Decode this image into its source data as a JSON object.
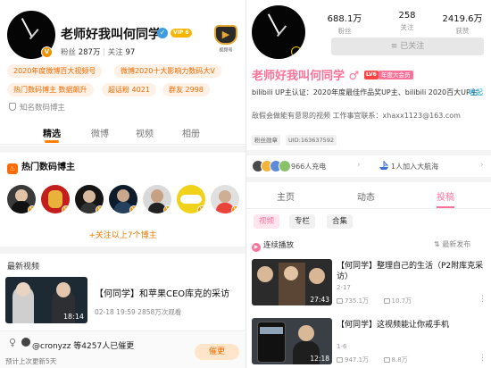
{
  "weibo": {
    "name": "老师好我叫何同学",
    "vip_tag": "VIP 6",
    "stats": {
      "fans_label": "粉丝",
      "fans": "287万",
      "follow_label": "关注",
      "follow": "97"
    },
    "power_badge_caption": "视频号",
    "tags": [
      "2020年度微博百大视频号",
      "微博2020十大影响力数码大V",
      "热门数码博主 数据飙升",
      "超话粉 4021",
      "群友 2998"
    ],
    "known_as": "知名数码博主",
    "tabs": [
      "精选",
      "微博",
      "视频",
      "相册"
    ],
    "hot_title": "热门数码博主",
    "follow_more": "+关注以上7个博主",
    "latest_label": "最新视频",
    "video": {
      "duration": "18:14",
      "title": "【何同学】和苹果CEO库克的采访",
      "meta": "02-18 19:59 2858万次观看"
    },
    "urge": {
      "text": "@cronyzz 等4257人已催更",
      "button": "催更",
      "next_update": "预计上次更新5天"
    }
  },
  "bilibili": {
    "stats": [
      {
        "value": "688.1万",
        "label": "粉丝"
      },
      {
        "value": "258",
        "label": "关注"
      },
      {
        "value": "2419.6万",
        "label": "获赞"
      }
    ],
    "followed_btn": "≡ 已关注",
    "name": "老师好我叫何同学 ♂",
    "lv": "LV6",
    "vip": "年度大会员",
    "cert": "bilibili UP主认证：2020年度最佳作品奖UP主、bilibili 2020百大UP主",
    "collapse": "收起",
    "bio": "敌假会做能有意思的视频    工作事宜联系：xhaxx1123@163.com",
    "chips": [
      "粉丝勋章",
      "UID:163637592"
    ],
    "charge_text": "966人充电",
    "fleet_text": "1人加入大航海",
    "tabs": [
      "主页",
      "动态",
      "投稿"
    ],
    "filters": [
      "视频",
      "专栏",
      "合集"
    ],
    "autoplay": "连续播放",
    "sort": "最新发布",
    "videos": [
      {
        "duration": "27:43",
        "title": "【何同学】整理自己的生活（P2附库克采访）",
        "date": "2-17",
        "plays": "735.1万",
        "danmaku": "10.7万"
      },
      {
        "duration": "12:18",
        "title": "【何同学】这视频能让你戒手机",
        "date": "1-6",
        "plays": "947.1万",
        "danmaku": "8.8万"
      }
    ]
  },
  "colors": {
    "weibo_orange": "#ff8200",
    "bili_pink": "#fb7299",
    "bili_blue": "#00a1d6"
  }
}
